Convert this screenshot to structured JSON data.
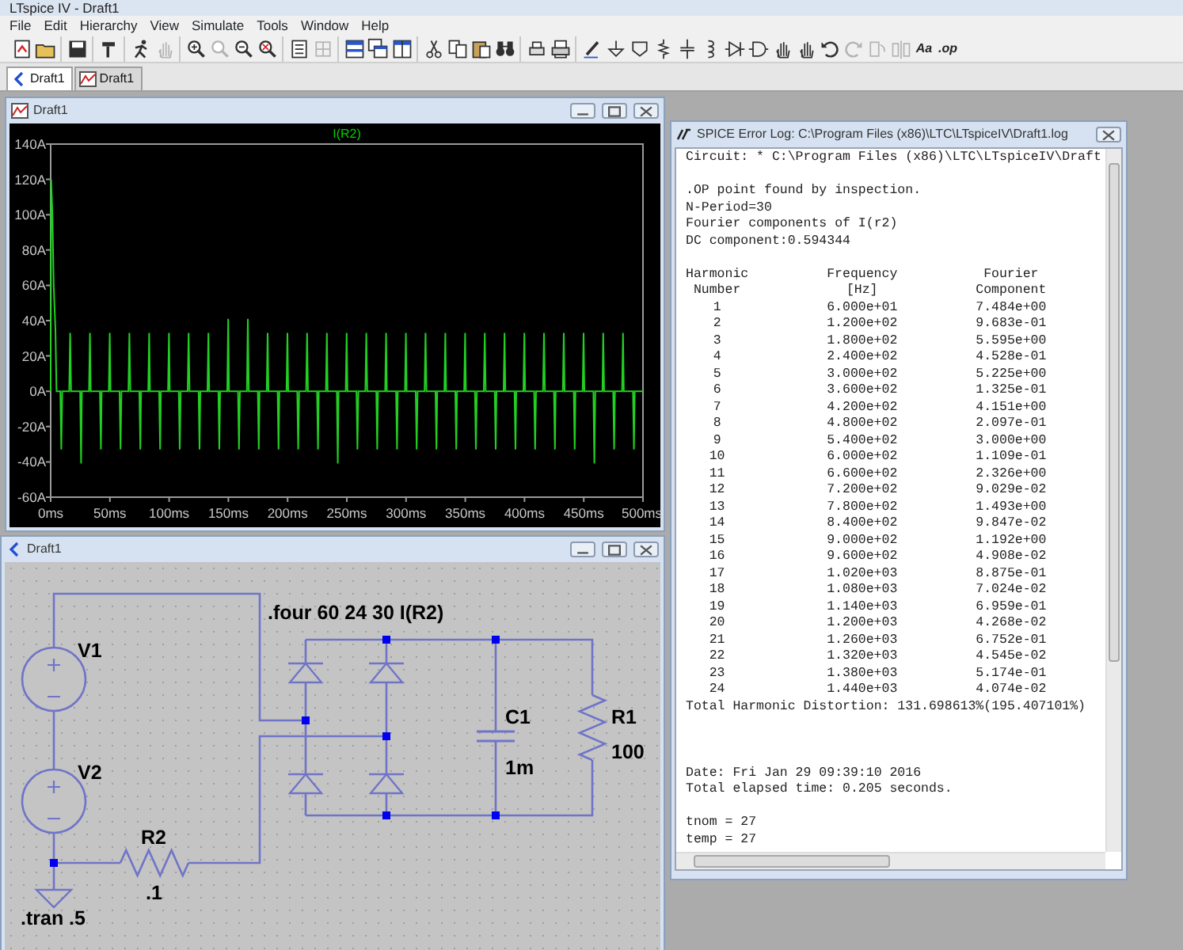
{
  "app": {
    "title": "LTspice IV - Draft1"
  },
  "menu": [
    "File",
    "Edit",
    "Hierarchy",
    "View",
    "Simulate",
    "Tools",
    "Window",
    "Help"
  ],
  "toolbar": [
    [
      {
        "kind": "icon",
        "disabled": false
      },
      {
        "kind": "icon",
        "disabled": false
      }
    ],
    [
      {
        "kind": "icon",
        "disabled": false
      }
    ],
    [
      {
        "kind": "icon",
        "disabled": false
      }
    ],
    [
      {
        "kind": "icon",
        "disabled": false
      },
      {
        "kind": "icon",
        "disabled": true
      }
    ],
    [
      {
        "kind": "icon",
        "disabled": false
      },
      {
        "kind": "icon",
        "disabled": true
      },
      {
        "kind": "icon",
        "disabled": false
      },
      {
        "kind": "icon",
        "disabled": false
      }
    ],
    [
      {
        "kind": "icon",
        "disabled": false
      },
      {
        "kind": "icon",
        "disabled": true
      }
    ],
    [
      {
        "kind": "icon",
        "disabled": false
      },
      {
        "kind": "icon",
        "disabled": false
      },
      {
        "kind": "icon",
        "disabled": false
      }
    ],
    [
      {
        "kind": "icon",
        "disabled": false
      },
      {
        "kind": "icon",
        "disabled": false
      },
      {
        "kind": "icon",
        "disabled": false
      },
      {
        "kind": "icon",
        "disabled": false
      }
    ],
    [
      {
        "kind": "icon",
        "disabled": false
      },
      {
        "kind": "icon",
        "disabled": false
      }
    ],
    [
      {
        "kind": "icon",
        "disabled": false
      },
      {
        "kind": "icon",
        "disabled": false
      },
      {
        "kind": "icon",
        "disabled": false
      },
      {
        "kind": "icon",
        "disabled": false
      },
      {
        "kind": "icon",
        "disabled": false
      },
      {
        "kind": "icon",
        "disabled": false
      },
      {
        "kind": "icon",
        "disabled": false
      },
      {
        "kind": "icon",
        "disabled": false
      },
      {
        "kind": "icon",
        "disabled": false
      },
      {
        "kind": "icon",
        "disabled": false
      },
      {
        "kind": "icon",
        "disabled": false
      },
      {
        "kind": "icon",
        "disabled": true
      },
      {
        "kind": "icon",
        "disabled": true
      },
      {
        "kind": "icon",
        "disabled": true
      },
      {
        "kind": "text",
        "label": "Aa",
        "disabled": false
      },
      {
        "kind": "text",
        "label": ".op",
        "disabled": false
      }
    ]
  ],
  "tabs": [
    {
      "kind": "schematic",
      "label": "Draft1",
      "selected": true
    },
    {
      "kind": "plot",
      "label": "Draft1",
      "selected": false
    }
  ],
  "plot_window": {
    "title": "Draft1",
    "trace_label": "I(R2)",
    "y_tick_labels": [
      "140A",
      "120A",
      "100A",
      "80A",
      "60A",
      "40A",
      "20A",
      "0A",
      "-20A",
      "-40A",
      "-60A"
    ],
    "x_tick_labels": [
      "0ms",
      "50ms",
      "100ms",
      "150ms",
      "200ms",
      "250ms",
      "300ms",
      "350ms",
      "400ms",
      "450ms",
      "500ms"
    ]
  },
  "schematic_window": {
    "title": "Draft1",
    "directives": [
      ".four 60 24 30 I(R2)",
      ".tran .5"
    ],
    "components": [
      {
        "kind": "voltage_source",
        "ref": "V1"
      },
      {
        "kind": "voltage_source",
        "ref": "V2"
      },
      {
        "kind": "resistor",
        "ref": "R2",
        "value": ".1"
      },
      {
        "kind": "capacitor",
        "ref": "C1",
        "value": "1m"
      },
      {
        "kind": "resistor",
        "ref": "R1",
        "value": "100"
      }
    ]
  },
  "log_window": {
    "title": "SPICE Error Log: C:\\Program Files (x86)\\LTC\\LTspiceIV\\Draft1.log",
    "circuit_line": "Circuit: * C:\\Program Files (x86)\\LTC\\LTspiceIV\\Draft",
    "preamble": [
      ".OP point found by inspection.",
      "N-Period=30",
      "Fourier components of I(r2)",
      "DC component:0.594344"
    ],
    "table_header": [
      [
        "Harmonic",
        "Frequency",
        "Fourier"
      ],
      [
        "Number",
        "[Hz]",
        "Component"
      ]
    ],
    "harmonics": [
      [
        "1",
        "6.000e+01",
        "7.484e+00"
      ],
      [
        "2",
        "1.200e+02",
        "9.683e-01"
      ],
      [
        "3",
        "1.800e+02",
        "5.595e+00"
      ],
      [
        "4",
        "2.400e+02",
        "4.528e-01"
      ],
      [
        "5",
        "3.000e+02",
        "5.225e+00"
      ],
      [
        "6",
        "3.600e+02",
        "1.325e-01"
      ],
      [
        "7",
        "4.200e+02",
        "4.151e+00"
      ],
      [
        "8",
        "4.800e+02",
        "2.097e-01"
      ],
      [
        "9",
        "5.400e+02",
        "3.000e+00"
      ],
      [
        "10",
        "6.000e+02",
        "1.109e-01"
      ],
      [
        "11",
        "6.600e+02",
        "2.326e+00"
      ],
      [
        "12",
        "7.200e+02",
        "9.029e-02"
      ],
      [
        "13",
        "7.800e+02",
        "1.493e+00"
      ],
      [
        "14",
        "8.400e+02",
        "9.847e-02"
      ],
      [
        "15",
        "9.000e+02",
        "1.192e+00"
      ],
      [
        "16",
        "9.600e+02",
        "4.908e-02"
      ],
      [
        "17",
        "1.020e+03",
        "8.875e-01"
      ],
      [
        "18",
        "1.080e+03",
        "7.024e-02"
      ],
      [
        "19",
        "1.140e+03",
        "6.959e-01"
      ],
      [
        "20",
        "1.200e+03",
        "4.268e-02"
      ],
      [
        "21",
        "1.260e+03",
        "6.752e-01"
      ],
      [
        "22",
        "1.320e+03",
        "4.545e-02"
      ],
      [
        "23",
        "1.380e+03",
        "5.174e-01"
      ],
      [
        "24",
        "1.440e+03",
        "4.074e-02"
      ]
    ],
    "summary": "Total Harmonic Distortion: 131.698613%(195.407101%)",
    "run_info": [
      "Date: Fri Jan 29 09:39:10 2016",
      "Total elapsed time: 0.205 seconds."
    ],
    "temperatures": [
      "tnom = 27",
      "temp = 27"
    ]
  }
}
